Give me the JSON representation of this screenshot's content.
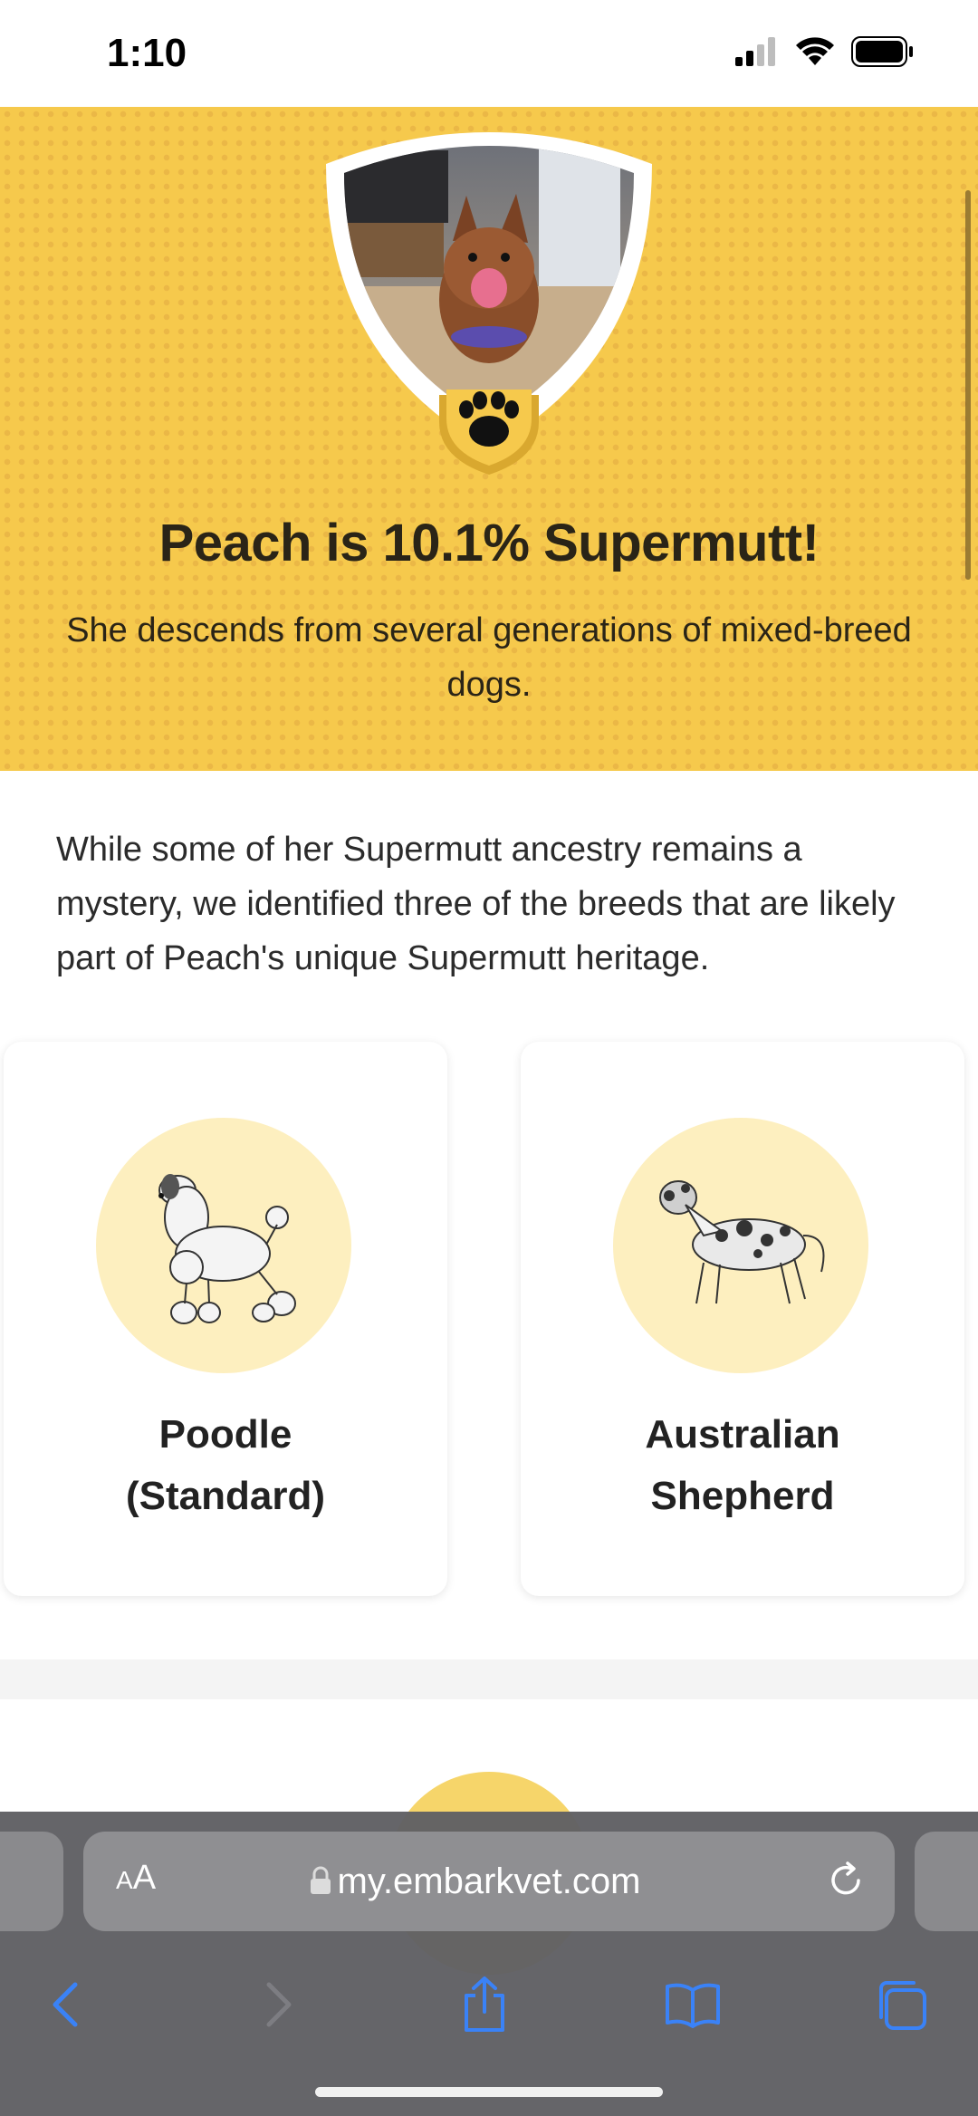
{
  "status_bar": {
    "time": "1:10"
  },
  "hero": {
    "title": "Peach is 10.1% Supermutt!",
    "subtitle": "She descends from several generations of mixed-breed dogs."
  },
  "intro": {
    "text": "While some of her Supermutt ancestry remains a mystery, we identified three of the breeds that are likely part of Peach's unique Supermutt heritage."
  },
  "breeds": [
    {
      "name_line1": "Poodle",
      "name_line2": "(Standard)"
    },
    {
      "name_line1": "Australian",
      "name_line2": "Shepherd"
    }
  ],
  "browser": {
    "aa_label_small": "A",
    "aa_label_large": "A",
    "url": "my.embarkvet.com"
  },
  "colors": {
    "hero_yellow": "#f6c94c",
    "breed_circle": "#fdefbf",
    "ios_blue": "#3a82f7"
  }
}
